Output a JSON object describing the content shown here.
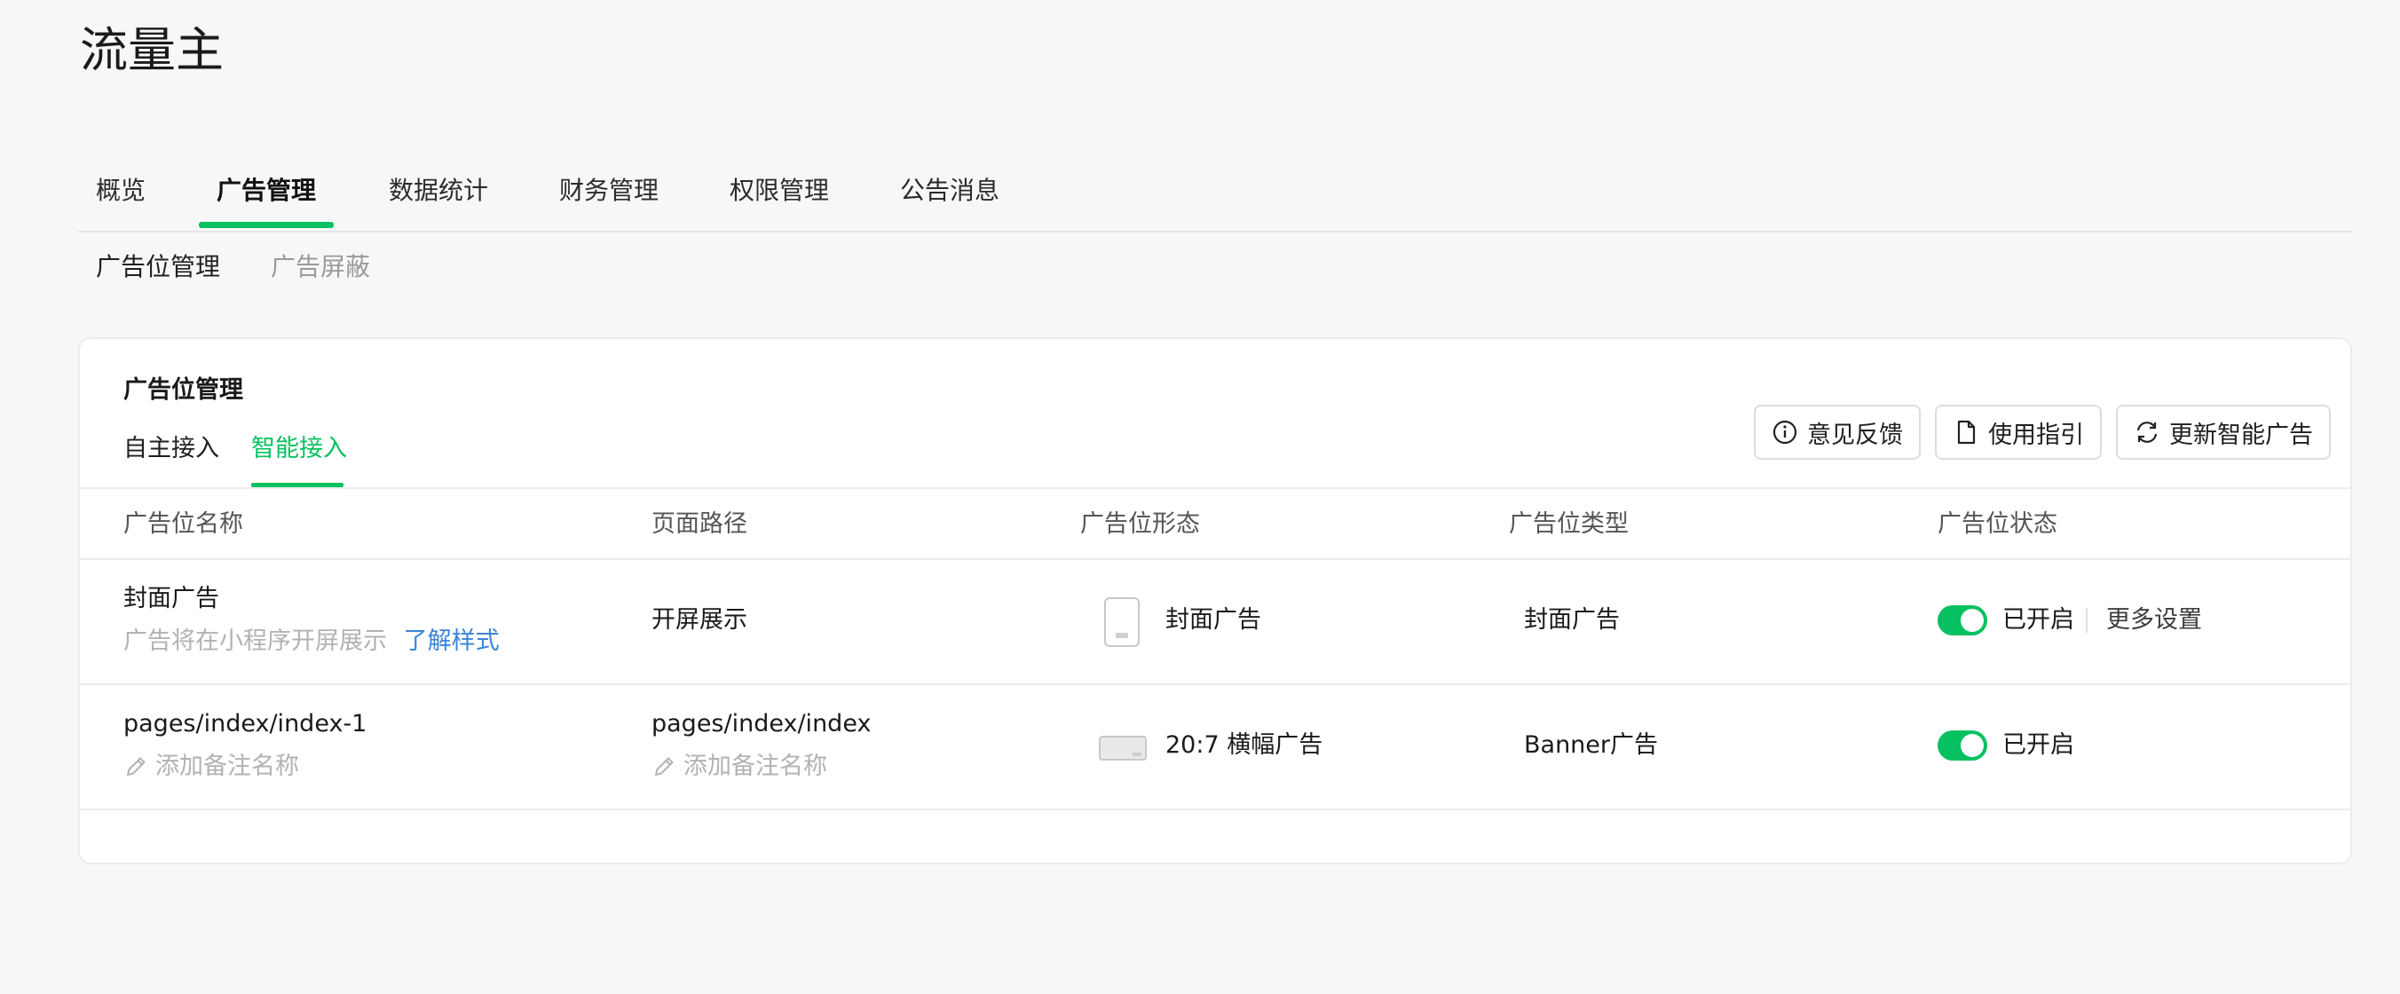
{
  "app": {
    "title": "流量主"
  },
  "main_tabs": [
    {
      "label": "概览",
      "active": false
    },
    {
      "label": "广告管理",
      "active": true
    },
    {
      "label": "数据统计",
      "active": false
    },
    {
      "label": "财务管理",
      "active": false
    },
    {
      "label": "权限管理",
      "active": false
    },
    {
      "label": "公告消息",
      "active": false
    }
  ],
  "sub_tabs": [
    {
      "label": "广告位管理",
      "active": true
    },
    {
      "label": "广告屏蔽",
      "active": false
    }
  ],
  "card": {
    "title": "广告位管理",
    "inner_tabs": [
      {
        "label": "自主接入",
        "active": false
      },
      {
        "label": "智能接入",
        "active": true
      }
    ],
    "buttons": {
      "feedback": {
        "label": "意见反馈",
        "icon": "info-icon"
      },
      "guide": {
        "label": "使用指引",
        "icon": "document-icon"
      },
      "refresh": {
        "label": "更新智能广告",
        "icon": "refresh-icon"
      }
    },
    "columns": [
      "广告位名称",
      "页面路径",
      "广告位形态",
      "广告位类型",
      "广告位状态"
    ],
    "rows": [
      {
        "name": "封面广告",
        "name_desc": "广告将在小程序开屏展示",
        "name_link": "了解样式",
        "path": "开屏展示",
        "path_note": "",
        "form_icon": "phone-portrait-icon",
        "form": "封面广告",
        "type": "封面广告",
        "status_on": true,
        "status": "已开启",
        "more": "更多设置"
      },
      {
        "name": "pages/index/index-1",
        "name_note": "添加备注名称",
        "path": "pages/index/index",
        "path_note": "添加备注名称",
        "form_icon": "banner-icon",
        "form": "20:7 横幅广告",
        "type": "Banner广告",
        "status_on": true,
        "status": "已开启"
      }
    ]
  },
  "colors": {
    "accent": "#07c160",
    "link": "#3a84d8",
    "muted": "#b2b2b2"
  }
}
